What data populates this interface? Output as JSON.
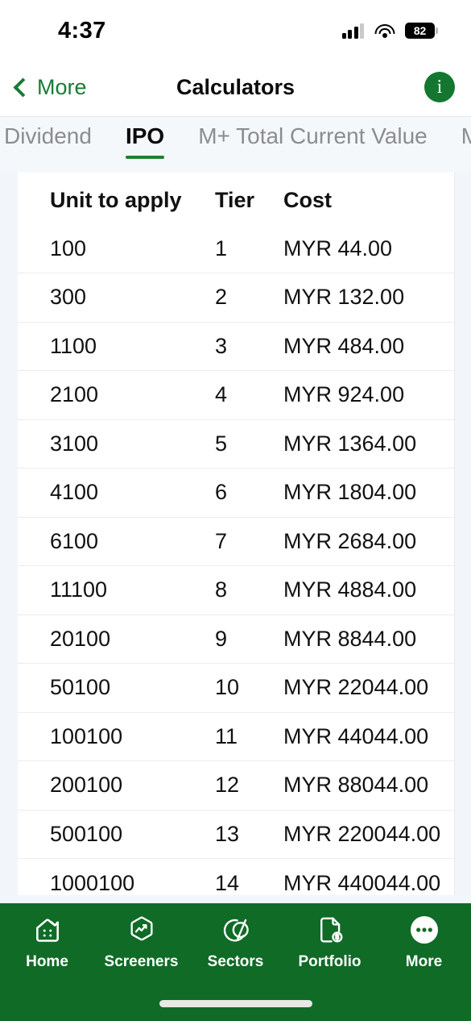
{
  "status_bar": {
    "time": "4:37",
    "battery_level": "82",
    "signal_icon": "cellular-signal-icon",
    "wifi_icon": "wifi-icon",
    "battery_icon": "battery-icon"
  },
  "nav_bar": {
    "back_label": "More",
    "title": "Calculators",
    "info_label": "i"
  },
  "tabs": {
    "items": [
      {
        "label": "Dividend",
        "active": false
      },
      {
        "label": "IPO",
        "active": true
      },
      {
        "label": "M+ Total Current Value",
        "active": false
      },
      {
        "label": "M+",
        "active": false
      }
    ]
  },
  "table": {
    "headers": [
      "Unit to apply",
      "Tier",
      "Cost"
    ],
    "rows": [
      {
        "unit": "100",
        "tier": "1",
        "cost": "MYR 44.00"
      },
      {
        "unit": "300",
        "tier": "2",
        "cost": "MYR 132.00"
      },
      {
        "unit": "1100",
        "tier": "3",
        "cost": "MYR 484.00"
      },
      {
        "unit": "2100",
        "tier": "4",
        "cost": "MYR 924.00"
      },
      {
        "unit": "3100",
        "tier": "5",
        "cost": "MYR 1364.00"
      },
      {
        "unit": "4100",
        "tier": "6",
        "cost": "MYR 1804.00"
      },
      {
        "unit": "6100",
        "tier": "7",
        "cost": "MYR 2684.00"
      },
      {
        "unit": "11100",
        "tier": "8",
        "cost": "MYR 4884.00"
      },
      {
        "unit": "20100",
        "tier": "9",
        "cost": "MYR 8844.00"
      },
      {
        "unit": "50100",
        "tier": "10",
        "cost": "MYR 22044.00"
      },
      {
        "unit": "100100",
        "tier": "11",
        "cost": "MYR 44044.00"
      },
      {
        "unit": "200100",
        "tier": "12",
        "cost": "MYR 88044.00"
      },
      {
        "unit": "500100",
        "tier": "13",
        "cost": "MYR 220044.00"
      },
      {
        "unit": "1000100",
        "tier": "14",
        "cost": "MYR 440044.00"
      }
    ]
  },
  "bottom_nav": {
    "items": [
      {
        "label": "Home",
        "icon": "home-icon",
        "active": false
      },
      {
        "label": "Screeners",
        "icon": "screeners-icon",
        "active": false
      },
      {
        "label": "Sectors",
        "icon": "sectors-icon",
        "active": false
      },
      {
        "label": "Portfolio",
        "icon": "portfolio-icon",
        "active": false
      },
      {
        "label": "More",
        "icon": "more-icon",
        "active": true
      }
    ]
  },
  "colors": {
    "brand_green": "#0f6b26",
    "accent_green": "#1f8038",
    "page_background": "#f2f5f9",
    "card_background": "#ffffff"
  }
}
